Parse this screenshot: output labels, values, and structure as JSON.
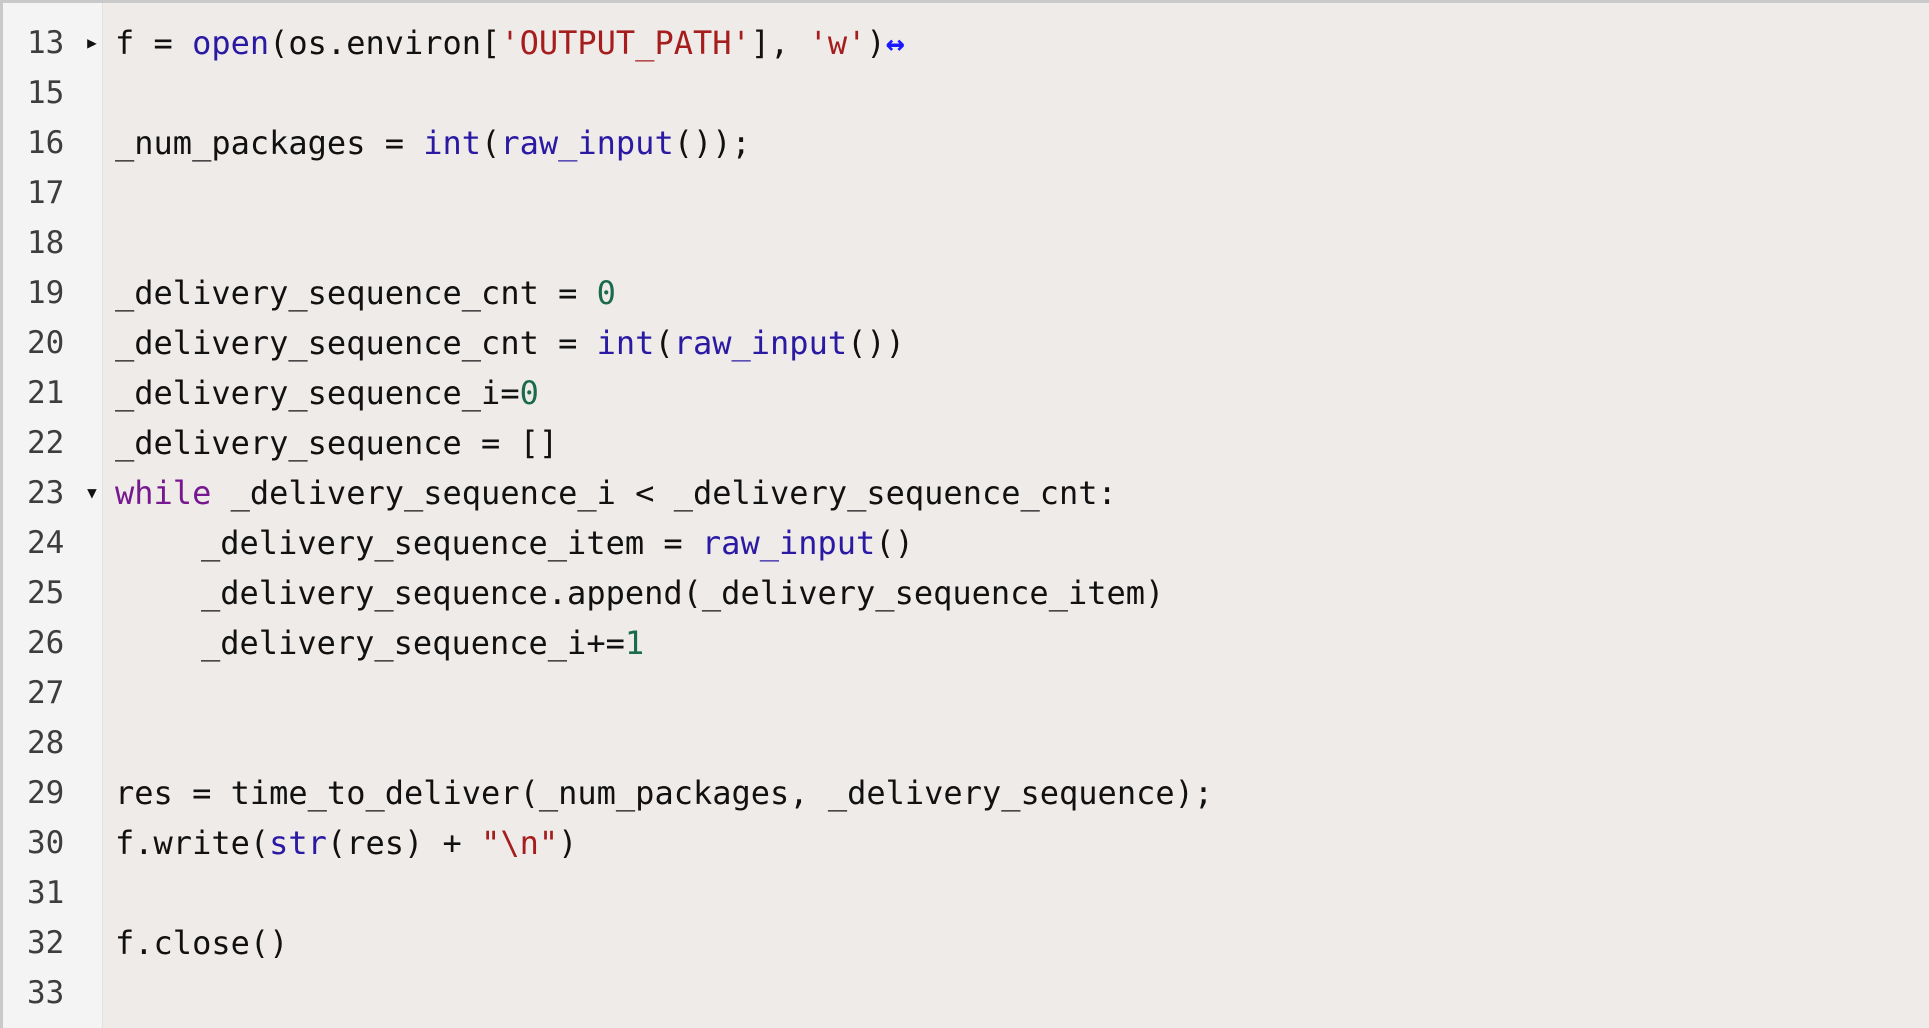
{
  "editor": {
    "lines": [
      {
        "no": "13",
        "fold": "▶",
        "tokens": [
          {
            "t": "f = ",
            "c": ""
          },
          {
            "t": "open",
            "c": "bi"
          },
          {
            "t": "(os.environ[",
            "c": ""
          },
          {
            "t": "'OUTPUT_PATH'",
            "c": "str"
          },
          {
            "t": "], ",
            "c": ""
          },
          {
            "t": "'w'",
            "c": "str"
          },
          {
            "t": ")",
            "c": ""
          }
        ],
        "collapsed": true,
        "collapse_glyph": "↔"
      },
      {
        "no": "15",
        "tokens": []
      },
      {
        "no": "16",
        "tokens": [
          {
            "t": "_num_packages = ",
            "c": ""
          },
          {
            "t": "int",
            "c": "bi"
          },
          {
            "t": "(",
            "c": ""
          },
          {
            "t": "raw_input",
            "c": "bi"
          },
          {
            "t": "());",
            "c": ""
          }
        ]
      },
      {
        "no": "17",
        "tokens": []
      },
      {
        "no": "18",
        "tokens": []
      },
      {
        "no": "19",
        "tokens": [
          {
            "t": "_delivery_sequence_cnt = ",
            "c": ""
          },
          {
            "t": "0",
            "c": "num"
          }
        ]
      },
      {
        "no": "20",
        "tokens": [
          {
            "t": "_delivery_sequence_cnt = ",
            "c": ""
          },
          {
            "t": "int",
            "c": "bi"
          },
          {
            "t": "(",
            "c": ""
          },
          {
            "t": "raw_input",
            "c": "bi"
          },
          {
            "t": "())",
            "c": ""
          }
        ]
      },
      {
        "no": "21",
        "tokens": [
          {
            "t": "_delivery_sequence_i=",
            "c": ""
          },
          {
            "t": "0",
            "c": "num"
          }
        ]
      },
      {
        "no": "22",
        "tokens": [
          {
            "t": "_delivery_sequence = []",
            "c": ""
          }
        ]
      },
      {
        "no": "23",
        "fold": "▼",
        "tokens": [
          {
            "t": "while",
            "c": "kw"
          },
          {
            "t": " _delivery_sequence_i < _delivery_sequence_cnt:",
            "c": ""
          }
        ]
      },
      {
        "no": "24",
        "indent": 1,
        "tokens": [
          {
            "t": "_delivery_sequence_item = ",
            "c": ""
          },
          {
            "t": "raw_input",
            "c": "bi"
          },
          {
            "t": "()",
            "c": ""
          }
        ]
      },
      {
        "no": "25",
        "indent": 1,
        "tokens": [
          {
            "t": "_delivery_sequence.append(_delivery_sequence_item)",
            "c": ""
          }
        ]
      },
      {
        "no": "26",
        "indent": 1,
        "tokens": [
          {
            "t": "_delivery_sequence_i+=",
            "c": ""
          },
          {
            "t": "1",
            "c": "num"
          }
        ]
      },
      {
        "no": "27",
        "tokens": []
      },
      {
        "no": "28",
        "tokens": []
      },
      {
        "no": "29",
        "tokens": [
          {
            "t": "res = time_to_deliver(_num_packages, _delivery_sequence);",
            "c": ""
          }
        ]
      },
      {
        "no": "30",
        "tokens": [
          {
            "t": "f.write(",
            "c": ""
          },
          {
            "t": "str",
            "c": "bi"
          },
          {
            "t": "(res) + ",
            "c": ""
          },
          {
            "t": "\"\\n\"",
            "c": "str"
          },
          {
            "t": ")",
            "c": ""
          }
        ]
      },
      {
        "no": "31",
        "tokens": []
      },
      {
        "no": "32",
        "tokens": [
          {
            "t": "f.close()",
            "c": ""
          }
        ]
      },
      {
        "no": "33",
        "tokens": []
      }
    ]
  },
  "colors": {
    "background": "#efebe9",
    "gutter": "#f4f4f4",
    "keyword": "#77198e",
    "builtin": "#2a1aa3",
    "string": "#a51d1d",
    "number": "#1a6a4f",
    "collapse_marker": "#1a1aff"
  },
  "icons": {
    "fold_collapsed": "triangle-right-icon",
    "fold_expanded": "triangle-down-icon",
    "collapsed_region": "double-arrow-icon"
  }
}
